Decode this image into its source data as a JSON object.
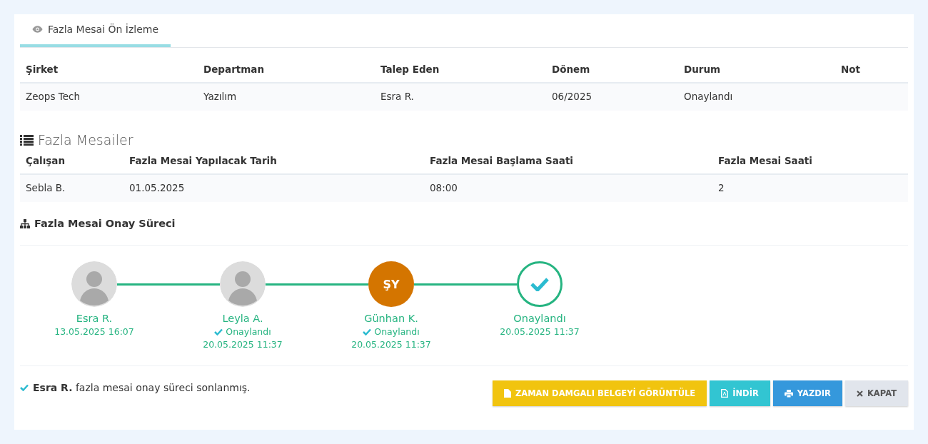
{
  "tab": {
    "label": "Fazla Mesai Ön İzleme",
    "selected": true
  },
  "summary_table": {
    "columns": [
      "Şirket",
      "Departman",
      "Talep Eden",
      "Dönem",
      "Durum",
      "Not"
    ],
    "rows": [
      [
        "Zeops Tech",
        "Yazılım",
        "Esra R.",
        "06/2025",
        "Onaylandı",
        ""
      ]
    ]
  },
  "overtime_section": {
    "title": "Fazla Mesailer",
    "columns": [
      "Çalışan",
      "Fazla Mesai Yapılacak Tarih",
      "Fazla Mesai Başlama Saati",
      "Fazla Mesai Saati"
    ],
    "rows": [
      [
        "Sebla B.",
        "01.05.2025",
        "08:00",
        "2"
      ]
    ]
  },
  "approval_section": {
    "title": "Fazla Mesai Onay Süreci",
    "steps": [
      {
        "kind": "photo",
        "name": "Esra R.",
        "time": "13.05.2025 16:07"
      },
      {
        "kind": "photo",
        "name": "Leyla A.",
        "status": "Onaylandı",
        "time": "20.05.2025 11:37"
      },
      {
        "kind": "initials",
        "initials": "ŞY",
        "color": "#d47500",
        "name": "Günhan K.",
        "status": "Onaylandı",
        "time": "20.05.2025 11:37"
      },
      {
        "kind": "done",
        "name": "Onaylandı",
        "time": "20.05.2025 11:37"
      }
    ]
  },
  "footer": {
    "message": "**Esra R.** fazla mesai onay süreci sonlanmış.",
    "buttons": [
      {
        "kind": "timestamp",
        "label": "ZAMAN DAMGALI BELGEYİ GÖRÜNTÜLE"
      },
      {
        "kind": "download",
        "label": "İNDİR"
      },
      {
        "kind": "print",
        "label": "YAZDIR"
      },
      {
        "kind": "close",
        "label": "KAPAT"
      }
    ]
  }
}
